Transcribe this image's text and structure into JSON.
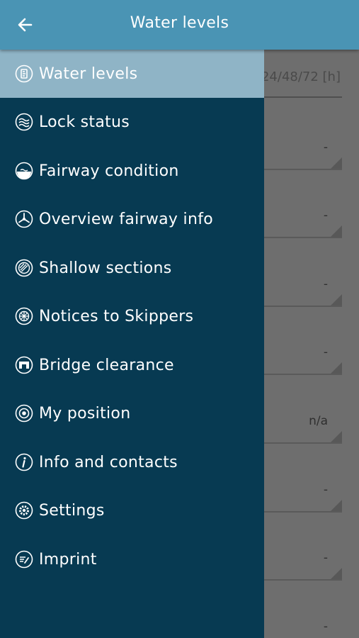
{
  "header": {
    "title": "Water levels",
    "back_icon": "arrow-left-icon"
  },
  "background": {
    "column_header": "24/48/72 [h]",
    "rows": [
      "-",
      "-",
      "-",
      "-",
      "n/a",
      "-",
      "-",
      "-"
    ]
  },
  "drawer": {
    "items": [
      {
        "label": "Water levels",
        "icon": "water-gauge-icon",
        "active": true
      },
      {
        "label": "Lock status",
        "icon": "waves-icon"
      },
      {
        "label": "Fairway condition",
        "icon": "fairway-icon"
      },
      {
        "label": "Overview fairway info",
        "icon": "propeller-icon"
      },
      {
        "label": "Shallow sections",
        "icon": "striped-circle-icon"
      },
      {
        "label": "Notices to Skippers",
        "icon": "grid-circle-icon"
      },
      {
        "label": "Bridge clearance",
        "icon": "bridge-icon"
      },
      {
        "label": "My position",
        "icon": "target-icon"
      },
      {
        "label": "Info and contacts",
        "icon": "info-icon"
      },
      {
        "label": "Settings",
        "icon": "gear-icon"
      },
      {
        "label": "Imprint",
        "icon": "document-pen-icon"
      }
    ]
  },
  "colors": {
    "header": "#4a94b4",
    "drawer": "#073a52",
    "active": "#8fb4c6"
  }
}
